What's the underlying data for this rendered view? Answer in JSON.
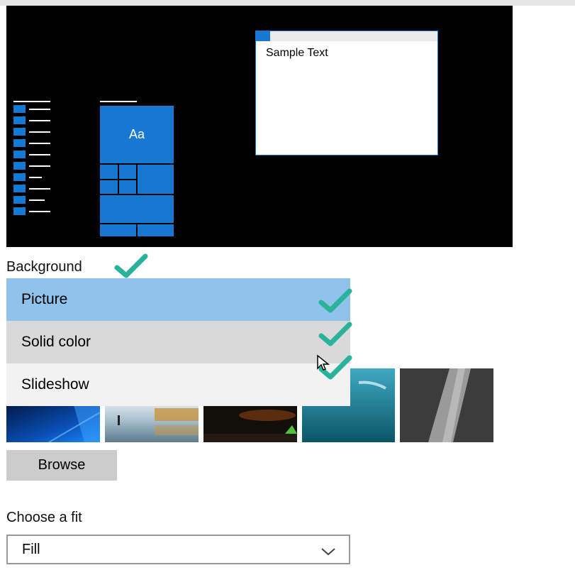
{
  "preview": {
    "sample_text": "Sample Text",
    "tile_label": "Aa"
  },
  "background": {
    "label": "Background",
    "options": [
      {
        "label": "Picture",
        "state": "selected"
      },
      {
        "label": "Solid color",
        "state": "hover"
      },
      {
        "label": "Slideshow",
        "state": "normal"
      }
    ]
  },
  "thumbnails": [
    {
      "name": "windows-blue-wallpaper"
    },
    {
      "name": "beach-reflection-wallpaper"
    },
    {
      "name": "night-tent-wallpaper"
    },
    {
      "name": "underwater-swimmer-wallpaper"
    },
    {
      "name": "rock-cliff-wallpaper"
    }
  ],
  "browse_label": "Browse",
  "fit": {
    "label": "Choose a fit",
    "value": "Fill"
  },
  "icons": {
    "checkmark": "checkmark-icon",
    "chevron": "chevron-down-icon",
    "cursor": "cursor-icon"
  },
  "colors": {
    "accent": "#1778d2",
    "selected_option": "#8fc3ec",
    "hover_option": "#d9d9d9",
    "checkmark": "#2ab39a"
  }
}
